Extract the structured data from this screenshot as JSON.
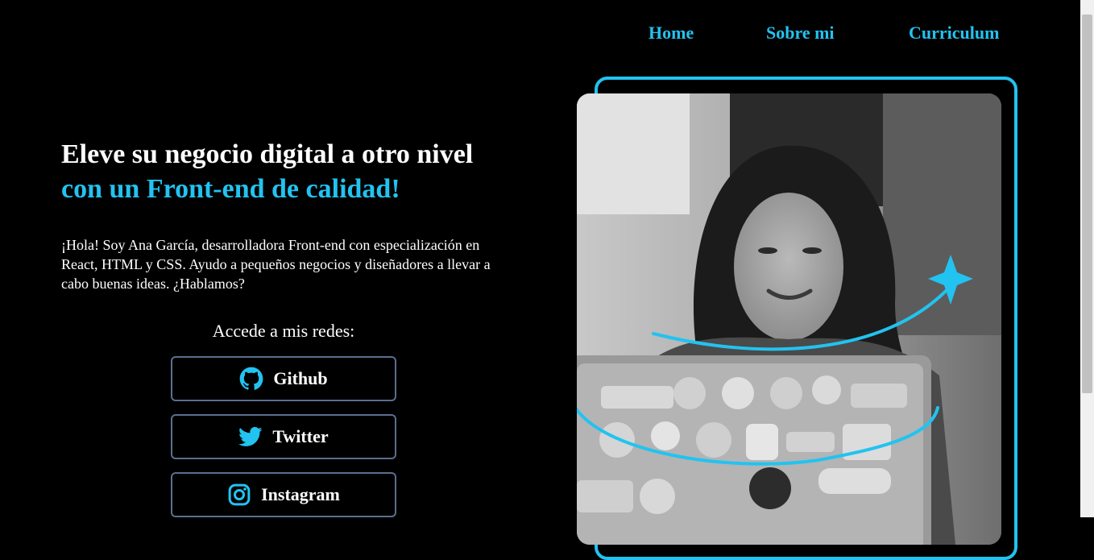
{
  "nav": {
    "home": "Home",
    "sobre": "Sobre mi",
    "curriculum": "Curriculum"
  },
  "hero": {
    "title_line1": "Eleve su negocio digital a otro nivel",
    "title_line2": "con un Front-end de calidad!",
    "intro": "¡Hola! Soy Ana García, desarrolladora Front-end con especialización en React, HTML y CSS. Ayudo a pequeños negocios y diseñadores a llevar a cabo buenas ideas. ¿Hablamos?"
  },
  "social": {
    "label": "Accede a mis redes:",
    "buttons": [
      {
        "label": "Github",
        "icon": "github-icon"
      },
      {
        "label": "Twitter",
        "icon": "twitter-icon"
      },
      {
        "label": "Instagram",
        "icon": "instagram-icon"
      }
    ]
  },
  "colors": {
    "accent": "#22c3f0",
    "background": "#000000",
    "button_border": "#5a6f8f"
  }
}
